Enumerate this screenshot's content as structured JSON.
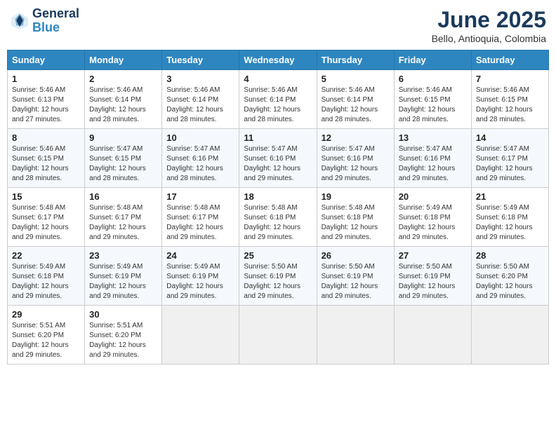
{
  "header": {
    "logo_line1": "General",
    "logo_line2": "Blue",
    "month_year": "June 2025",
    "location": "Bello, Antioquia, Colombia"
  },
  "days_of_week": [
    "Sunday",
    "Monday",
    "Tuesday",
    "Wednesday",
    "Thursday",
    "Friday",
    "Saturday"
  ],
  "weeks": [
    [
      {
        "day": "1",
        "sunrise": "Sunrise: 5:46 AM",
        "sunset": "Sunset: 6:13 PM",
        "daylight": "Daylight: 12 hours and 27 minutes."
      },
      {
        "day": "2",
        "sunrise": "Sunrise: 5:46 AM",
        "sunset": "Sunset: 6:14 PM",
        "daylight": "Daylight: 12 hours and 28 minutes."
      },
      {
        "day": "3",
        "sunrise": "Sunrise: 5:46 AM",
        "sunset": "Sunset: 6:14 PM",
        "daylight": "Daylight: 12 hours and 28 minutes."
      },
      {
        "day": "4",
        "sunrise": "Sunrise: 5:46 AM",
        "sunset": "Sunset: 6:14 PM",
        "daylight": "Daylight: 12 hours and 28 minutes."
      },
      {
        "day": "5",
        "sunrise": "Sunrise: 5:46 AM",
        "sunset": "Sunset: 6:14 PM",
        "daylight": "Daylight: 12 hours and 28 minutes."
      },
      {
        "day": "6",
        "sunrise": "Sunrise: 5:46 AM",
        "sunset": "Sunset: 6:15 PM",
        "daylight": "Daylight: 12 hours and 28 minutes."
      },
      {
        "day": "7",
        "sunrise": "Sunrise: 5:46 AM",
        "sunset": "Sunset: 6:15 PM",
        "daylight": "Daylight: 12 hours and 28 minutes."
      }
    ],
    [
      {
        "day": "8",
        "sunrise": "Sunrise: 5:46 AM",
        "sunset": "Sunset: 6:15 PM",
        "daylight": "Daylight: 12 hours and 28 minutes."
      },
      {
        "day": "9",
        "sunrise": "Sunrise: 5:47 AM",
        "sunset": "Sunset: 6:15 PM",
        "daylight": "Daylight: 12 hours and 28 minutes."
      },
      {
        "day": "10",
        "sunrise": "Sunrise: 5:47 AM",
        "sunset": "Sunset: 6:16 PM",
        "daylight": "Daylight: 12 hours and 28 minutes."
      },
      {
        "day": "11",
        "sunrise": "Sunrise: 5:47 AM",
        "sunset": "Sunset: 6:16 PM",
        "daylight": "Daylight: 12 hours and 29 minutes."
      },
      {
        "day": "12",
        "sunrise": "Sunrise: 5:47 AM",
        "sunset": "Sunset: 6:16 PM",
        "daylight": "Daylight: 12 hours and 29 minutes."
      },
      {
        "day": "13",
        "sunrise": "Sunrise: 5:47 AM",
        "sunset": "Sunset: 6:16 PM",
        "daylight": "Daylight: 12 hours and 29 minutes."
      },
      {
        "day": "14",
        "sunrise": "Sunrise: 5:47 AM",
        "sunset": "Sunset: 6:17 PM",
        "daylight": "Daylight: 12 hours and 29 minutes."
      }
    ],
    [
      {
        "day": "15",
        "sunrise": "Sunrise: 5:48 AM",
        "sunset": "Sunset: 6:17 PM",
        "daylight": "Daylight: 12 hours and 29 minutes."
      },
      {
        "day": "16",
        "sunrise": "Sunrise: 5:48 AM",
        "sunset": "Sunset: 6:17 PM",
        "daylight": "Daylight: 12 hours and 29 minutes."
      },
      {
        "day": "17",
        "sunrise": "Sunrise: 5:48 AM",
        "sunset": "Sunset: 6:17 PM",
        "daylight": "Daylight: 12 hours and 29 minutes."
      },
      {
        "day": "18",
        "sunrise": "Sunrise: 5:48 AM",
        "sunset": "Sunset: 6:18 PM",
        "daylight": "Daylight: 12 hours and 29 minutes."
      },
      {
        "day": "19",
        "sunrise": "Sunrise: 5:48 AM",
        "sunset": "Sunset: 6:18 PM",
        "daylight": "Daylight: 12 hours and 29 minutes."
      },
      {
        "day": "20",
        "sunrise": "Sunrise: 5:49 AM",
        "sunset": "Sunset: 6:18 PM",
        "daylight": "Daylight: 12 hours and 29 minutes."
      },
      {
        "day": "21",
        "sunrise": "Sunrise: 5:49 AM",
        "sunset": "Sunset: 6:18 PM",
        "daylight": "Daylight: 12 hours and 29 minutes."
      }
    ],
    [
      {
        "day": "22",
        "sunrise": "Sunrise: 5:49 AM",
        "sunset": "Sunset: 6:18 PM",
        "daylight": "Daylight: 12 hours and 29 minutes."
      },
      {
        "day": "23",
        "sunrise": "Sunrise: 5:49 AM",
        "sunset": "Sunset: 6:19 PM",
        "daylight": "Daylight: 12 hours and 29 minutes."
      },
      {
        "day": "24",
        "sunrise": "Sunrise: 5:49 AM",
        "sunset": "Sunset: 6:19 PM",
        "daylight": "Daylight: 12 hours and 29 minutes."
      },
      {
        "day": "25",
        "sunrise": "Sunrise: 5:50 AM",
        "sunset": "Sunset: 6:19 PM",
        "daylight": "Daylight: 12 hours and 29 minutes."
      },
      {
        "day": "26",
        "sunrise": "Sunrise: 5:50 AM",
        "sunset": "Sunset: 6:19 PM",
        "daylight": "Daylight: 12 hours and 29 minutes."
      },
      {
        "day": "27",
        "sunrise": "Sunrise: 5:50 AM",
        "sunset": "Sunset: 6:19 PM",
        "daylight": "Daylight: 12 hours and 29 minutes."
      },
      {
        "day": "28",
        "sunrise": "Sunrise: 5:50 AM",
        "sunset": "Sunset: 6:20 PM",
        "daylight": "Daylight: 12 hours and 29 minutes."
      }
    ],
    [
      {
        "day": "29",
        "sunrise": "Sunrise: 5:51 AM",
        "sunset": "Sunset: 6:20 PM",
        "daylight": "Daylight: 12 hours and 29 minutes."
      },
      {
        "day": "30",
        "sunrise": "Sunrise: 5:51 AM",
        "sunset": "Sunset: 6:20 PM",
        "daylight": "Daylight: 12 hours and 29 minutes."
      },
      null,
      null,
      null,
      null,
      null
    ]
  ]
}
